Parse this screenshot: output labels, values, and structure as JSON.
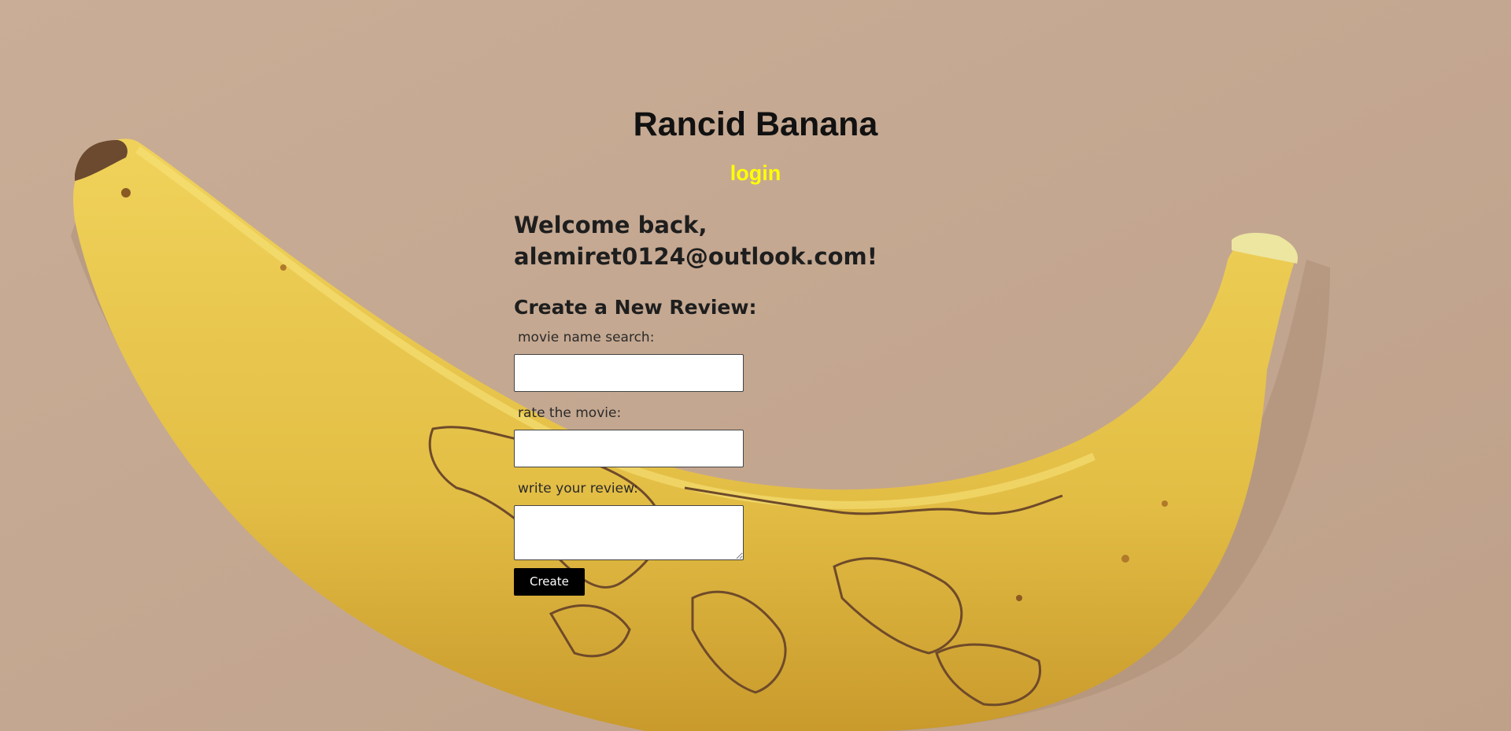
{
  "header": {
    "title": "Rancid Banana",
    "nav_login": "login"
  },
  "main": {
    "welcome": "Welcome back, alemiret0124@outlook.com!",
    "form": {
      "heading": "Create a New Review:",
      "movie_label": "movie name search:",
      "movie_value": "",
      "rating_label": "rate the movie:",
      "rating_value": "",
      "review_label": "write your review:",
      "review_value": "",
      "submit_label": "Create"
    }
  },
  "colors": {
    "background": "#c7ab94",
    "login_link": "#ffff00",
    "banana": "#e6c14a",
    "button": "#000000"
  },
  "background_image": "banana-with-world-map-carved"
}
